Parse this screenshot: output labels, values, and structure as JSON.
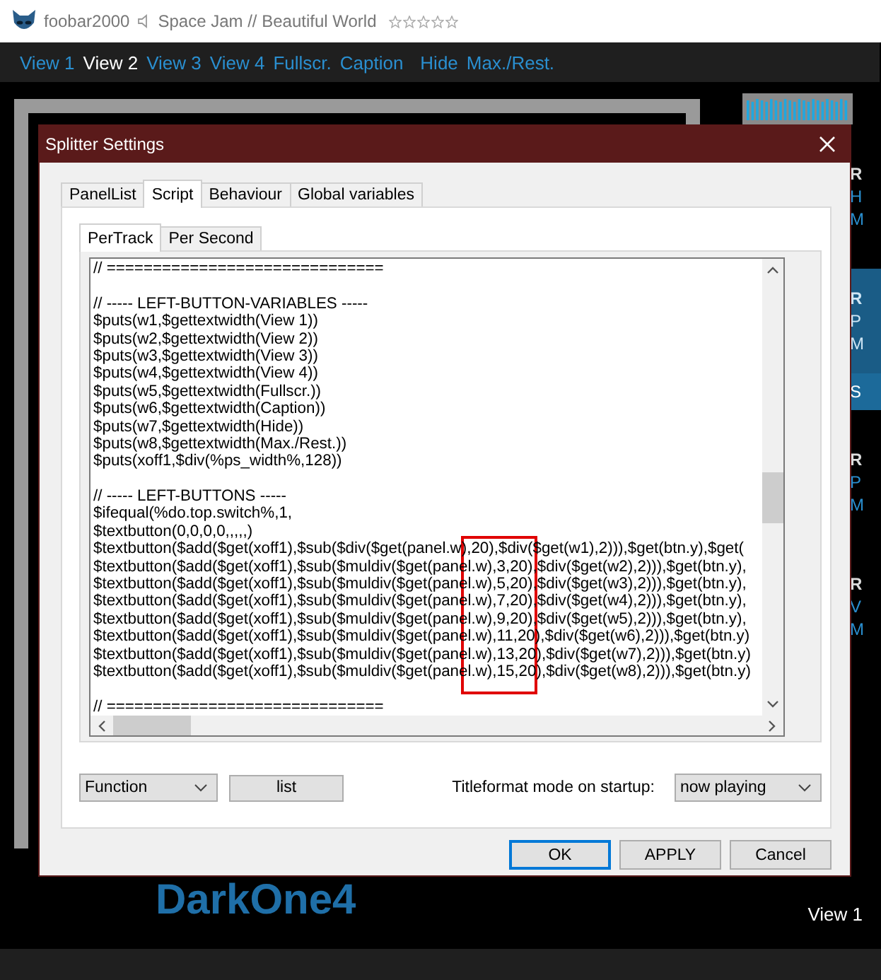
{
  "window": {
    "app": "foobar2000",
    "now_playing": "Space Jam // Beautiful World",
    "stars": 0
  },
  "menu": [
    {
      "label": "View 1",
      "selected": false
    },
    {
      "label": "View 2",
      "selected": true
    },
    {
      "label": "View 3",
      "selected": false
    },
    {
      "label": "View 4",
      "selected": false
    },
    {
      "label": "Fullscr.",
      "selected": false
    },
    {
      "label": "Caption",
      "selected": false
    },
    {
      "label": "Hide",
      "selected": false
    },
    {
      "label": "Max./Rest.",
      "selected": false
    }
  ],
  "side_cards": [
    {
      "lines": [
        "R",
        "H",
        "M"
      ],
      "selected": false
    },
    {
      "lines": [
        "R",
        "P",
        "M"
      ],
      "selected": true
    },
    {
      "lines": [
        "R",
        "P",
        "M"
      ],
      "selected": false
    },
    {
      "lines": [
        "R",
        "V",
        "M"
      ],
      "selected": false
    }
  ],
  "side_bar_label": "S",
  "logo": "DarkOne4",
  "footer_view": "View 1",
  "dialog": {
    "title": "Splitter Settings",
    "tabs": [
      {
        "label": "PanelList",
        "selected": false
      },
      {
        "label": "Script",
        "selected": true
      },
      {
        "label": "Behaviour",
        "selected": false
      },
      {
        "label": "Global variables",
        "selected": false
      }
    ],
    "subtabs": [
      {
        "label": "PerTrack",
        "selected": true
      },
      {
        "label": "Per Second",
        "selected": false
      }
    ],
    "code_blocks": [
      {
        "lines": [
          "// =============================="
        ]
      },
      {
        "lines": [
          "// ----- LEFT-BUTTON-VARIABLES -----",
          "$puts(w1,$gettextwidth(View 1))",
          "$puts(w2,$gettextwidth(View 2))",
          "$puts(w3,$gettextwidth(View 3))",
          "$puts(w4,$gettextwidth(View 4))",
          "$puts(w5,$gettextwidth(Fullscr.))",
          "$puts(w6,$gettextwidth(Caption))",
          "$puts(w7,$gettextwidth(Hide))",
          "$puts(w8,$gettextwidth(Max./Rest.))",
          "$puts(xoff1,$div(%ps_width%,128))"
        ]
      },
      {
        "lines": [
          "// ----- LEFT-BUTTONS -----",
          "$ifequal(%do.top.switch%,1,",
          "$textbutton(0,0,0,0,,,,,)",
          "$textbutton($add($get(xoff1),$sub($div($get(panel.w),20),$div($get(w1),2))),$get(btn.y),$get(",
          "$textbutton($add($get(xoff1),$sub($muldiv($get(panel.w),3,20),$div($get(w2),2))),$get(btn.y),",
          "$textbutton($add($get(xoff1),$sub($muldiv($get(panel.w),5,20),$div($get(w3),2))),$get(btn.y),",
          "$textbutton($add($get(xoff1),$sub($muldiv($get(panel.w),7,20),$div($get(w4),2))),$get(btn.y),",
          "$textbutton($add($get(xoff1),$sub($muldiv($get(panel.w),9,20),$div($get(w5),2))),$get(btn.y),",
          "$textbutton($add($get(xoff1),$sub($muldiv($get(panel.w),11,20),$div($get(w6),2))),$get(btn.y)",
          "$textbutton($add($get(xoff1),$sub($muldiv($get(panel.w),13,20),$div($get(w7),2))),$get(btn.y)",
          "$textbutton($add($get(xoff1),$sub($muldiv($get(panel.w),15,20),$div($get(w8),2))),$get(btn.y)"
        ]
      },
      {
        "lines": [
          "// =============================="
        ]
      }
    ],
    "function_select": "Function",
    "list_button": "list",
    "startup_label": "Titleformat mode on startup:",
    "startup_select": "now playing",
    "buttons": [
      {
        "label": "OK",
        "kind": "default"
      },
      {
        "label": "APPLY",
        "kind": "normal"
      },
      {
        "label": "Cancel",
        "kind": "normal"
      }
    ]
  }
}
